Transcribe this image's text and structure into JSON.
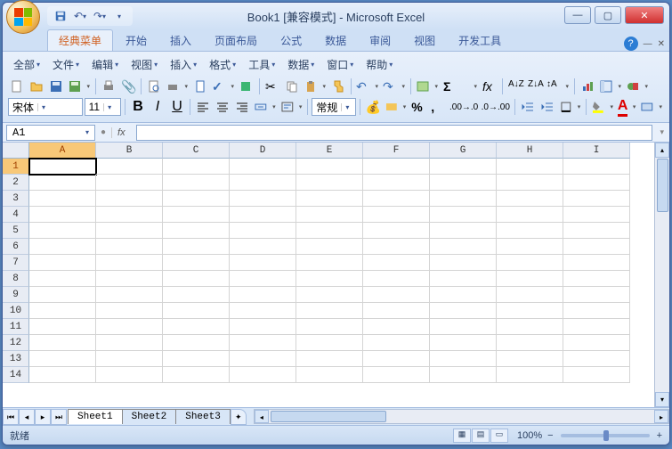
{
  "title": "Book1  [兼容模式] - Microsoft Excel",
  "qat": {
    "save": "保存",
    "undo": "撤销",
    "redo": "重做"
  },
  "ribbonTabs": [
    "经典菜单",
    "开始",
    "插入",
    "页面布局",
    "公式",
    "数据",
    "审阅",
    "视图",
    "开发工具"
  ],
  "activeTab": 0,
  "classicMenu": [
    "全部",
    "文件",
    "编辑",
    "视图",
    "插入",
    "格式",
    "工具",
    "数据",
    "窗口",
    "帮助"
  ],
  "format": {
    "font": "宋体",
    "size": "11",
    "bold": "B",
    "italic": "I",
    "underline": "U",
    "numberFormat": "常规"
  },
  "nameBox": "A1",
  "fxLabel": "fx",
  "columns": [
    "A",
    "B",
    "C",
    "D",
    "E",
    "F",
    "G",
    "H",
    "I"
  ],
  "rowCount": 14,
  "activeCell": {
    "row": 1,
    "col": "A"
  },
  "sheets": [
    "Sheet1",
    "Sheet2",
    "Sheet3"
  ],
  "activeSheet": 0,
  "status": "就绪",
  "zoom": "100%",
  "zoomMinus": "−",
  "zoomPlus": "+"
}
